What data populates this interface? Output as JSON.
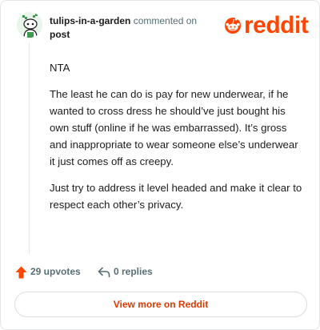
{
  "comment": {
    "username": "tulips-in-a-garden",
    "action_text": "commented on",
    "post_link": "post",
    "body": [
      "NTA",
      "The least he can do is pay for new underwear, if he wanted to cross dress he should’ve just bought his own stuff (online if he was embarrassed). It’s gross and inappropriate to wear someone else’s underwear it just comes off as creepy.",
      "Just try to address it level headed and make it clear to respect each other’s privacy."
    ],
    "upvotes_label": "29 upvotes",
    "replies_label": "0 replies"
  },
  "brand": {
    "wordmark": "reddit",
    "color": "#ff4500"
  },
  "footer": {
    "view_more_label": "View more on Reddit"
  },
  "colors": {
    "accent": "#ff4500",
    "link": "#d93a00",
    "muted": "#576f76",
    "border": "#e4e6e8"
  },
  "icons": {
    "avatar": "user-avatar-icon",
    "logo": "reddit-logo-icon",
    "upvote": "upvote-arrow-icon",
    "reply": "reply-arrow-icon"
  }
}
